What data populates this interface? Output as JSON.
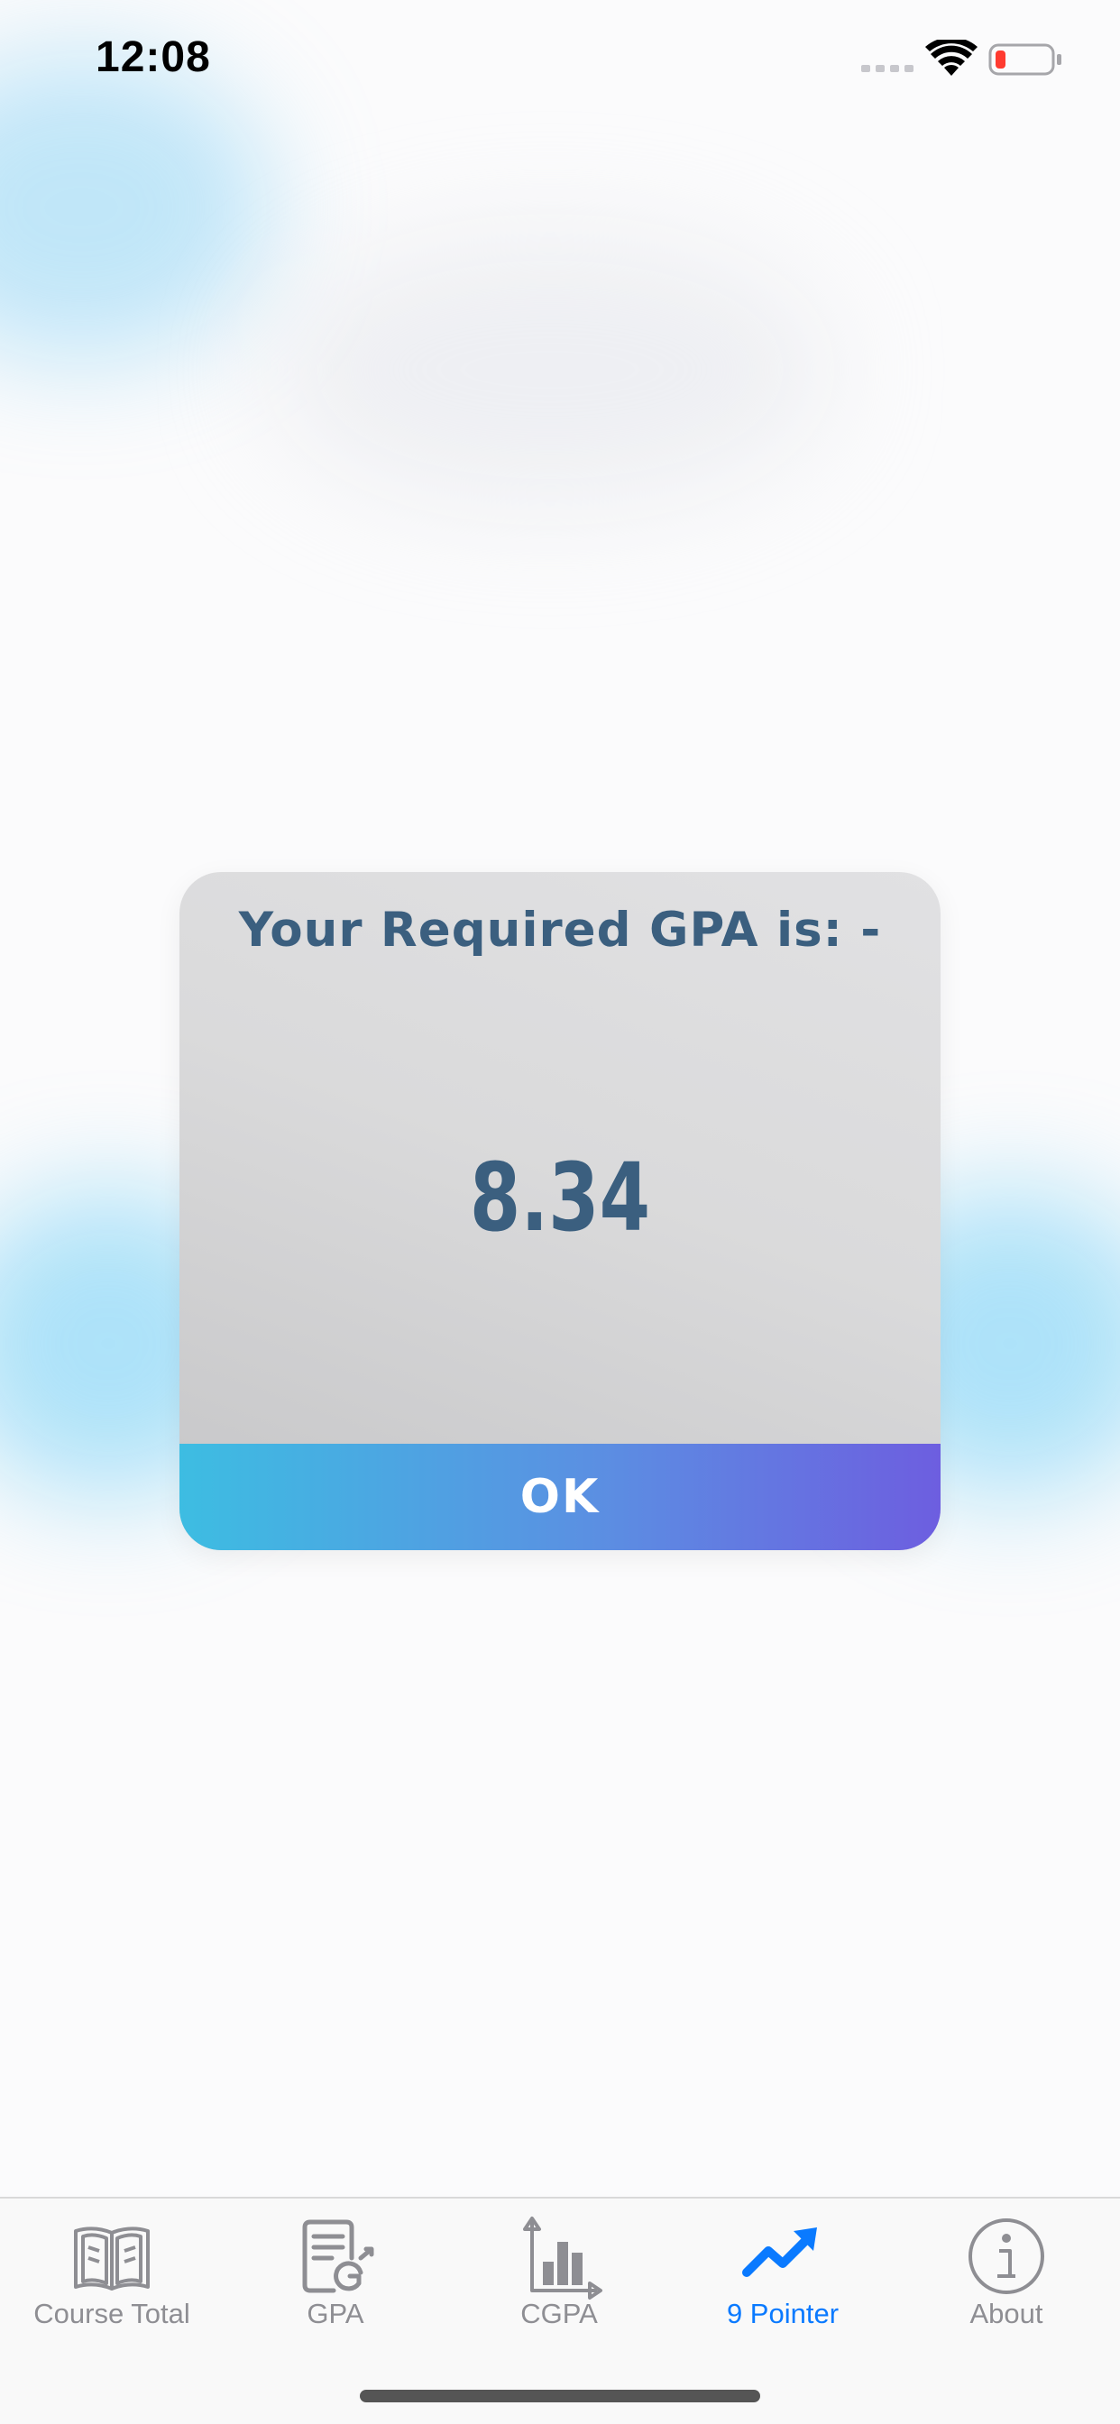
{
  "status_bar": {
    "time": "12:08"
  },
  "dialog": {
    "title": "Your Required GPA is: -",
    "value": "8.34",
    "ok_label": "OK"
  },
  "tab_bar": {
    "tabs": [
      {
        "label": "Course Total",
        "icon": "book-icon",
        "active": false
      },
      {
        "label": "GPA",
        "icon": "gpa-document-icon",
        "active": false
      },
      {
        "label": "CGPA",
        "icon": "bar-chart-icon",
        "active": false
      },
      {
        "label": "9 Pointer",
        "icon": "trending-up-icon",
        "active": true
      },
      {
        "label": "About",
        "icon": "info-icon",
        "active": false
      }
    ]
  },
  "colors": {
    "accent": "#0a7aff",
    "inactive_tab": "#8e8e93",
    "dialog_text": "#3b5f7f",
    "ok_gradient_start": "#3dbde2",
    "ok_gradient_end": "#6d5ee0"
  }
}
